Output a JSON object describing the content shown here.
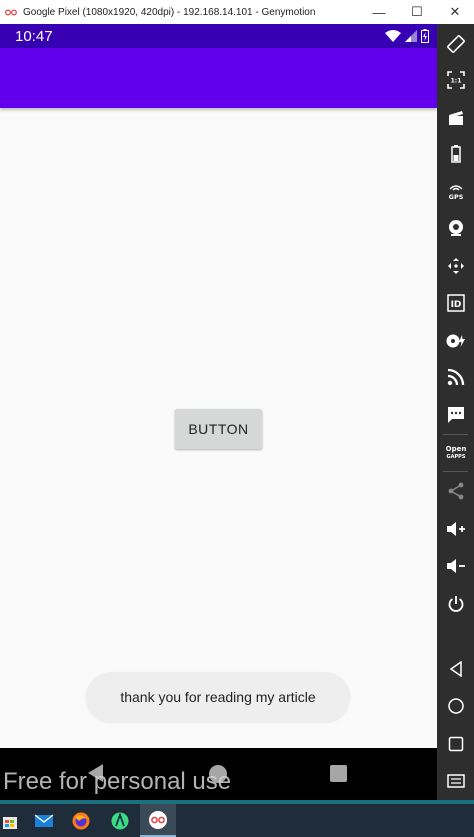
{
  "window": {
    "title": "Google Pixel (1080x1920, 420dpi) - 192.168.14.101 - Genymotion",
    "controls": {
      "minimize": "—",
      "maximize": "☐",
      "close": "✕"
    }
  },
  "statusbar": {
    "time": "10:47",
    "icons": [
      "wifi-icon",
      "signal-icon",
      "battery-icon"
    ]
  },
  "colors": {
    "status_bar": "#3700b3",
    "app_bar": "#6200ee",
    "background": "#fafafa",
    "button": "#d6d7d7",
    "toast": "#eeeeee",
    "sidebar": "#2e2e2e",
    "taskbar": "#1f2d3a"
  },
  "main": {
    "button_label": "BUTTON",
    "toast_text": "thank you for reading my article"
  },
  "navbar": {
    "icons": [
      "back-icon",
      "home-icon",
      "recents-icon"
    ]
  },
  "watermark": "Free for personal use",
  "sidebar": {
    "tools": [
      {
        "name": "rotate-icon"
      },
      {
        "name": "pixel-perfect-icon",
        "label": "1:1"
      },
      {
        "name": "screencast-icon"
      },
      {
        "name": "battery-tool-icon"
      },
      {
        "name": "gps-icon",
        "label": "GPS"
      },
      {
        "name": "webcam-icon"
      },
      {
        "name": "remote-control-icon"
      },
      {
        "name": "device-id-icon",
        "label": "ID"
      },
      {
        "name": "disk-io-icon"
      },
      {
        "name": "network-icon"
      },
      {
        "name": "sms-icon"
      },
      {
        "name": "open-gapps-icon",
        "label": "Open GAPPS"
      },
      {
        "name": "share-icon"
      },
      {
        "name": "volume-up-icon"
      },
      {
        "name": "volume-down-icon"
      },
      {
        "name": "power-icon"
      },
      {
        "name": "back-tool-icon"
      },
      {
        "name": "home-tool-icon"
      },
      {
        "name": "recents-tool-icon"
      },
      {
        "name": "menu-tool-icon"
      }
    ]
  },
  "taskbar": {
    "items": [
      "store-icon",
      "mail-icon",
      "firefox-icon",
      "android-studio-icon",
      "genymotion-icon"
    ]
  }
}
